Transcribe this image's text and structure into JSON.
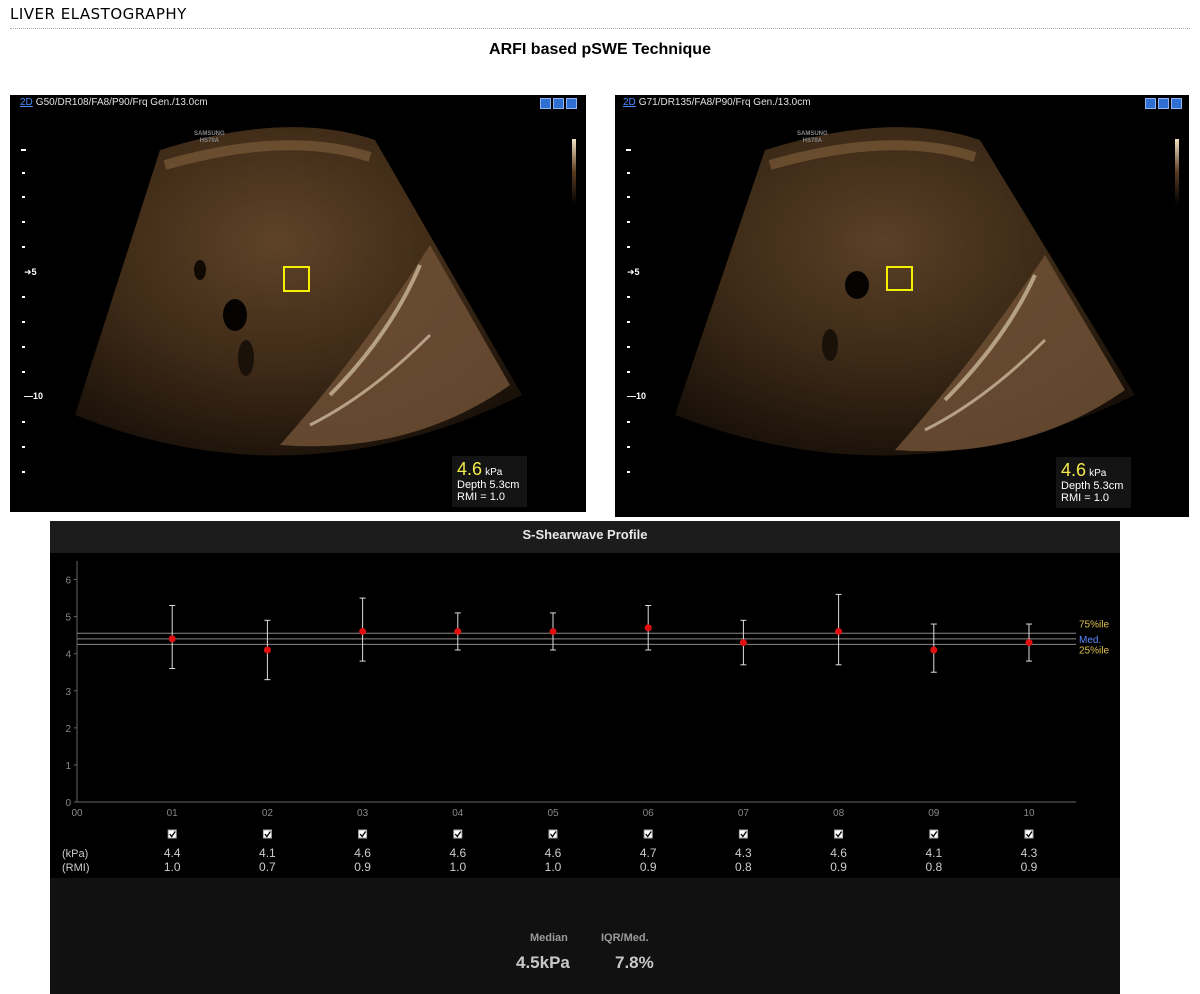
{
  "header": {
    "title": "LIVER  ELASTOGRAPHY",
    "subtitle": "ARFI based pSWE Technique"
  },
  "images": [
    {
      "mode": "2D",
      "params": "G50/DR108/FA8/P90/Frq Gen./13.0cm",
      "brand": "SAMSUNG",
      "model": "HS70A",
      "depth_marks": [
        "5",
        "10"
      ],
      "value": "4.6",
      "unit": "kPa",
      "depth": "Depth 5.3cm",
      "rmi": "RMI = 1.0"
    },
    {
      "mode": "2D",
      "params": "G71/DR135/FA8/P90/Frq Gen./13.0cm",
      "brand": "SAMSUNG",
      "model": "HS70A",
      "depth_marks": [
        "5",
        "10"
      ],
      "value": "4.6",
      "unit": "kPa",
      "depth": "Depth 5.3cm",
      "rmi": "RMI = 1.0"
    }
  ],
  "profile": {
    "title": "S-Shearwave Profile",
    "row_labels": {
      "kpa": "(kPa)",
      "rmi": "(RMI)"
    },
    "median_label": "Median",
    "median_value": "4.5kPa",
    "iqr_label": "IQR/Med.",
    "iqr_value": "7.8%"
  },
  "colors": {
    "point": "#e01010",
    "pct_line": "#e0c050",
    "median_line": "#5a8cff",
    "errorbar": "#dddddd"
  },
  "chart_data": {
    "type": "scatter",
    "title": "S-Shearwave Profile",
    "x_tick_labels": [
      "00",
      "01",
      "02",
      "03",
      "04",
      "05",
      "06",
      "07",
      "08",
      "09",
      "10"
    ],
    "y_ticks": [
      0,
      1,
      2,
      3,
      4,
      5,
      6
    ],
    "ylim": [
      0,
      6.5
    ],
    "points": [
      {
        "x": "01",
        "y": 4.4,
        "low": 3.6,
        "high": 5.3,
        "kpa": "4.4",
        "rmi": "1.0"
      },
      {
        "x": "02",
        "y": 4.1,
        "low": 3.3,
        "high": 4.9,
        "kpa": "4.1",
        "rmi": "0.7"
      },
      {
        "x": "03",
        "y": 4.6,
        "low": 3.8,
        "high": 5.5,
        "kpa": "4.6",
        "rmi": "0.9"
      },
      {
        "x": "04",
        "y": 4.6,
        "low": 4.1,
        "high": 5.1,
        "kpa": "4.6",
        "rmi": "1.0"
      },
      {
        "x": "05",
        "y": 4.6,
        "low": 4.1,
        "high": 5.1,
        "kpa": "4.6",
        "rmi": "1.0"
      },
      {
        "x": "06",
        "y": 4.7,
        "low": 4.1,
        "high": 5.3,
        "kpa": "4.7",
        "rmi": "0.9"
      },
      {
        "x": "07",
        "y": 4.3,
        "low": 3.7,
        "high": 4.9,
        "kpa": "4.3",
        "rmi": "0.8"
      },
      {
        "x": "08",
        "y": 4.6,
        "low": 3.7,
        "high": 5.6,
        "kpa": "4.6",
        "rmi": "0.9"
      },
      {
        "x": "09",
        "y": 4.1,
        "low": 3.5,
        "high": 4.8,
        "kpa": "4.1",
        "rmi": "0.8"
      },
      {
        "x": "10",
        "y": 4.3,
        "low": 3.8,
        "high": 4.8,
        "kpa": "4.3",
        "rmi": "0.9"
      }
    ],
    "reference_lines": [
      {
        "name": "75%ile",
        "y": 4.55
      },
      {
        "name": "Med.",
        "y": 4.4
      },
      {
        "name": "25%ile",
        "y": 4.25
      }
    ]
  }
}
